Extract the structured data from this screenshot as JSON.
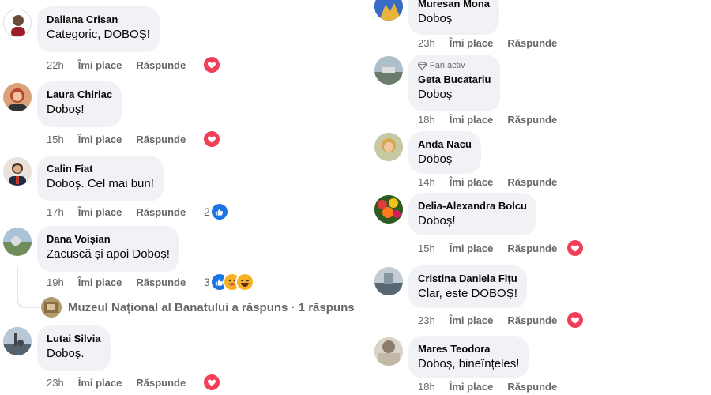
{
  "actions": {
    "like": "Îmi place",
    "reply": "Răspunde"
  },
  "left": [
    {
      "author": "Daliana Crisan",
      "text": "Categoric, DOBOȘ!",
      "time": "22h"
    },
    {
      "author": "Laura Chiriac",
      "text": "Doboș!",
      "time": "15h"
    },
    {
      "author": "Calin Fiat",
      "text": "Doboș. Cel mai bun!",
      "time": "17h",
      "reaction_count": "2"
    },
    {
      "author": "Dana Voișian",
      "text": "Zacuscă și apoi Doboș!",
      "time": "19h",
      "reaction_count": "3"
    },
    {
      "author": "Lutai Silvia",
      "text": "Doboș.",
      "time": "23h"
    }
  ],
  "thread_reply": {
    "text": "Muzeul Național al Banatului a răspuns · 1 răspuns"
  },
  "right": [
    {
      "author": "Muresan Mona",
      "text": "Doboș",
      "time": "23h"
    },
    {
      "badge": "Fan activ",
      "author": "Geta Bucatariu",
      "text": "Doboș",
      "time": "18h"
    },
    {
      "author": "Anda Nacu",
      "text": "Doboș",
      "time": "14h"
    },
    {
      "author": "Delia-Alexandra Bolcu",
      "text": "Doboș!",
      "time": "15h"
    },
    {
      "author": "Cristina Daniela Fițu",
      "text": "Clar, este DOBOȘ!",
      "time": "23h"
    },
    {
      "author": "Mares Teodora",
      "text": "Doboș, bineînțeles!",
      "time": "18h"
    }
  ],
  "colors": {
    "bubble": "#f0f2f5",
    "meta": "#65676b",
    "heart": "#f33e58",
    "like": "#1b74e4",
    "haha": "#f7b125"
  }
}
